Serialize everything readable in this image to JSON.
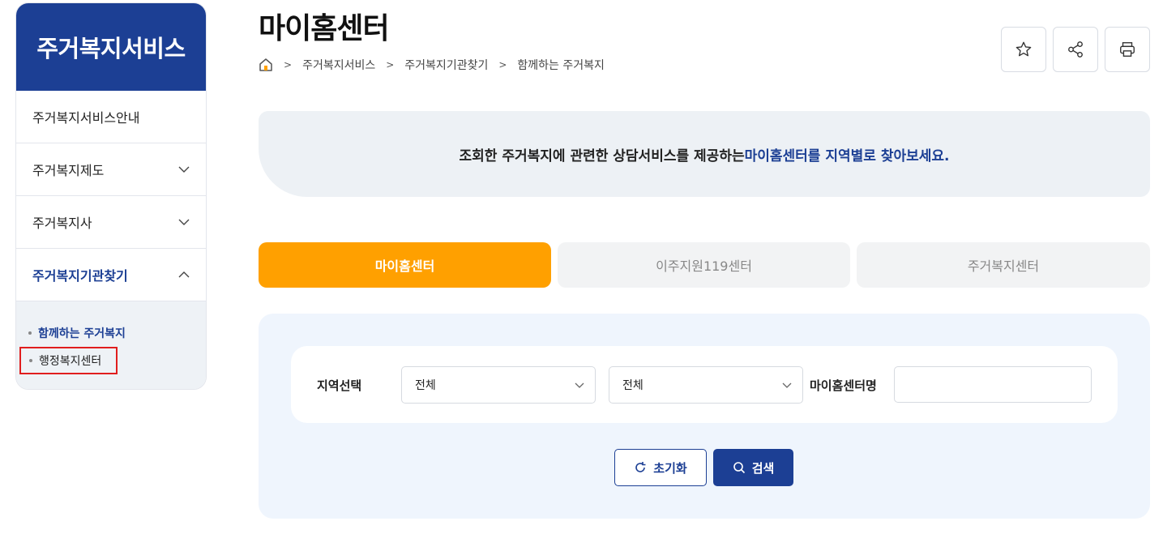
{
  "sidebar": {
    "title": "주거복지서비스",
    "items": [
      {
        "label": "주거복지서비스안내"
      },
      {
        "label": "주거복지제도"
      },
      {
        "label": "주거복지사"
      },
      {
        "label": "주거복지기관찾기"
      }
    ],
    "sub_items": [
      {
        "label": "함께하는 주거복지"
      },
      {
        "label": "행정복지센터"
      }
    ]
  },
  "page": {
    "title": "마이홈센터",
    "breadcrumb": [
      "주거복지서비스",
      "주거복지기관찾기",
      "함께하는 주거복지"
    ]
  },
  "banner": {
    "text_plain": "조회한 주거복지에 관련한 상담서비스를 제공하는 ",
    "text_highlight": "마이홈센터를 지역별로 찾아보세요."
  },
  "tabs": [
    {
      "label": "마이홈센터"
    },
    {
      "label": "이주지원119센터"
    },
    {
      "label": "주거복지센터"
    }
  ],
  "search": {
    "region_label": "지역선택",
    "region1_value": "전체",
    "region2_value": "전체",
    "center_name_label": "마이홈센터명",
    "center_name_value": "",
    "reset_label": "초기화",
    "search_label": "검색"
  },
  "colors": {
    "brand": "#1c3f94",
    "tab_active": "#ffa000",
    "highlight_box": "#e01e1e"
  }
}
